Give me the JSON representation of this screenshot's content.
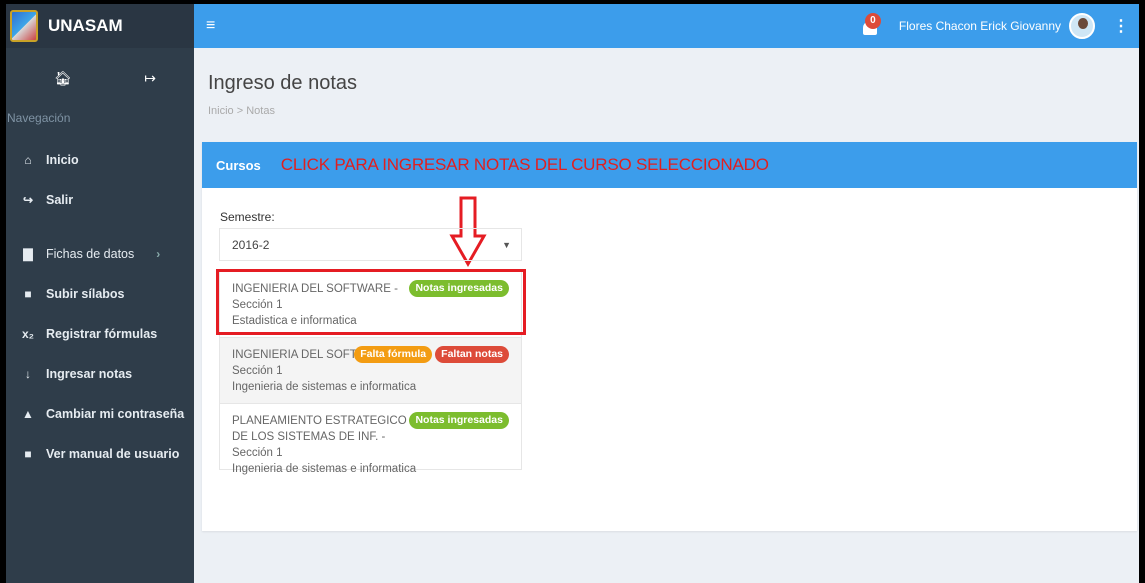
{
  "brand": {
    "name": "UNASAM"
  },
  "sidebar": {
    "heading": "Navegación",
    "items": [
      {
        "label": "Inicio",
        "icon": "home-icon"
      },
      {
        "label": "Salir",
        "icon": "sign-out-icon"
      },
      {
        "label": "Fichas de datos",
        "icon": "bar-chart-icon"
      },
      {
        "label": "Subir sílabos",
        "icon": "book-icon"
      },
      {
        "label": "Registrar fórmulas",
        "icon": "subscript-icon"
      },
      {
        "label": "Ingresar notas",
        "icon": "sort-numeric-icon"
      },
      {
        "label": "Cambiar mi contraseña",
        "icon": "lock-icon"
      },
      {
        "label": "Ver manual de usuario",
        "icon": "book-icon"
      }
    ]
  },
  "topbar": {
    "notification_count": "0",
    "user_name": "Flores Chacon Erick Giovanny"
  },
  "page": {
    "title": "Ingreso de notas",
    "breadcrumb": "Inicio  >  Notas"
  },
  "box": {
    "title": "Cursos",
    "annotation": "CLICK PARA INGRESAR NOTAS DEL CURSO SELECCIONADO",
    "semester_label": "Semestre:",
    "semester_value": "2016-2"
  },
  "courses": [
    {
      "name": "INGENIERIA DEL SOFTWARE - Sección 1",
      "career": "Estadistica e informatica",
      "badges": [
        "Notas ingresadas"
      ]
    },
    {
      "name": "INGENIERIA DEL SOFTWARE I - Sección 1",
      "career": "Ingenieria de sistemas e informatica",
      "badges": [
        "Falta fórmula",
        "Faltan notas"
      ]
    },
    {
      "name": "PLANEAMIENTO ESTRATEGICO DE LOS SISTEMAS DE INF. - Sección 1",
      "career": "Ingenieria de sistemas e informatica",
      "badges": [
        "Notas ingresadas"
      ]
    }
  ],
  "colors": {
    "primary": "#3c9deb",
    "sidebar": "#2f3d4a",
    "success": "#7cbd2e",
    "warning": "#f39c12",
    "danger": "#dd4b39",
    "annotation": "#e02020"
  }
}
